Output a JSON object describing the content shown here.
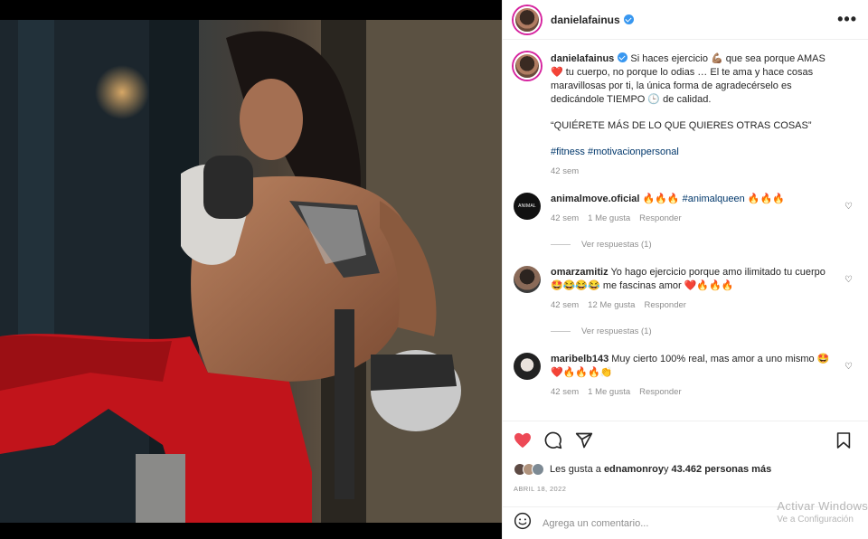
{
  "post": {
    "username": "danielafainus",
    "caption": {
      "username": "danielafainus",
      "text_1": "Si haces ejercicio 💪🏽 que sea porque AMAS ❤️ tu cuerpo, no porque lo odias … El te ama y hace cosas maravillosas por ti, la única forma de agradecérselo es dedicándole TIEMPO 🕒 de calidad.",
      "quote": "“QUIÉRETE MÁS DE LO QUE QUIERES OTRAS COSAS”",
      "hashtags": "#fitness #motivacionpersonal",
      "time": "42 sem"
    },
    "comments": [
      {
        "username": "animalmove.oficial",
        "avatar_text": "ANIMAL",
        "text_pre": "🔥🔥🔥 ",
        "tag": "#animalqueen",
        "text_post": " 🔥🔥🔥",
        "time": "42 sem",
        "likes": "1 Me gusta",
        "reply": "Responder",
        "view_replies": "Ver respuestas (1)"
      },
      {
        "username": "omarzamitiz",
        "text": "Yo hago ejercicio porque amo ilimitado tu cuerpo 🤩😂😂😂 me fascinas amor ❤️🔥🔥🔥",
        "time": "42 sem",
        "likes": "12 Me gusta",
        "reply": "Responder",
        "view_replies": "Ver respuestas (1)"
      },
      {
        "username": "maribelb143",
        "text": "Muy cierto 100% real, mas amor a uno mismo 🤩 ❤️🔥🔥🔥👏",
        "time": "42 sem",
        "likes": "1 Me gusta",
        "reply": "Responder"
      }
    ],
    "likes": {
      "prefix": "Les gusta a ",
      "first_user": "ednamonroy",
      "connector": " y ",
      "count": "43.462 personas más"
    },
    "date": "ABRIL 18, 2022",
    "comment_placeholder": "Agrega un comentario...",
    "icons": [
      "heart-icon",
      "comment-icon",
      "share-icon",
      "bookmark-icon",
      "emoji-icon",
      "more-icon",
      "verified-badge"
    ],
    "colors": {
      "like_red": "#ed4956",
      "link_blue": "#00376b",
      "verified_blue": "#3897f0"
    }
  },
  "watermark": {
    "line1": "Activar Windows",
    "line2": "Ve a Configuración"
  }
}
